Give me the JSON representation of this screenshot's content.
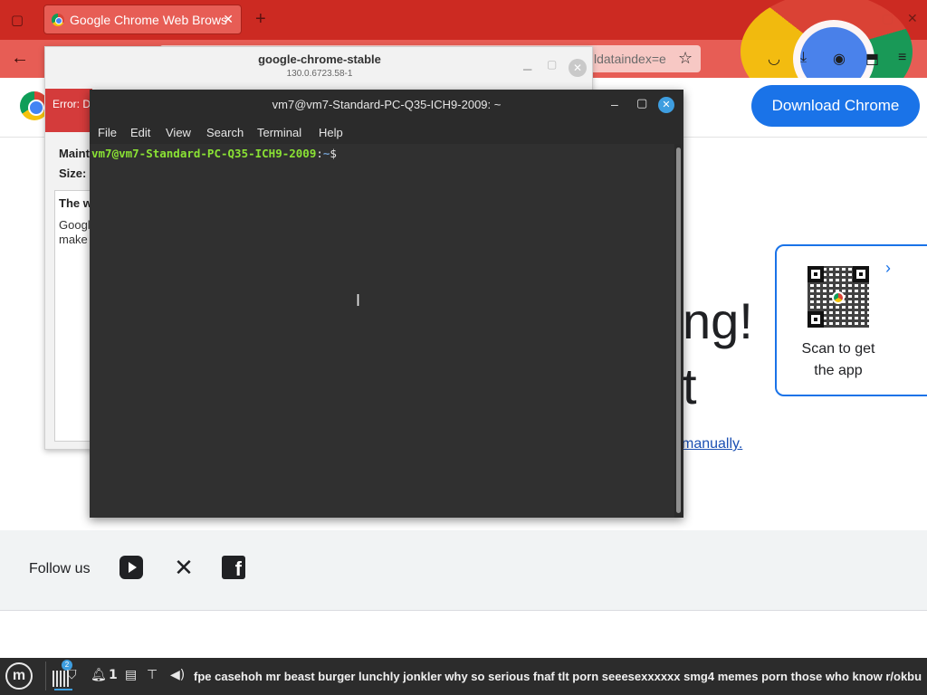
{
  "firefox": {
    "tab_title": "Google Chrome Web Brows",
    "url_fragment": "ldataindex=e",
    "icons": [
      "tab-list-icon",
      "back-icon",
      "star-icon",
      "pocket-icon",
      "download-icon",
      "account-icon",
      "extensions-icon",
      "hamburger-menu-icon"
    ]
  },
  "page": {
    "download_button": "Download Chrome",
    "big_text_1": "ng!",
    "big_text_2": "t",
    "manual_link": "manually.",
    "qr_caption": "Scan to get the app",
    "follow_us": "Follow us",
    "social": [
      "youtube-icon",
      "x-icon",
      "facebook-icon"
    ]
  },
  "installer": {
    "title": "google-chrome-stable",
    "version": "130.0.6723.58-1",
    "error": "Error: D",
    "maint_label": "Maint",
    "size_label": "Size:",
    "desc_heading": "The w",
    "desc_text_1": "Googl",
    "desc_text_2": "make"
  },
  "terminal": {
    "title": "vm7@vm7-Standard-PC-Q35-ICH9-2009: ~",
    "menu": [
      "File",
      "Edit",
      "View",
      "Search",
      "Terminal",
      "Help"
    ],
    "prompt_user": "vm7@vm7-Standard-PC-Q35-ICH9-2009",
    "prompt_sep": ":",
    "prompt_path": "~",
    "prompt_symbol": "$"
  },
  "taskbar": {
    "badge_count": "2",
    "workspace_num": "1",
    "panel_text": "fpe casehoh mr beast burger lunchly jonkler why so serious fnaf tlt porn   seeesexxxxxx smg4 memes porn  those who know r/okbu"
  }
}
